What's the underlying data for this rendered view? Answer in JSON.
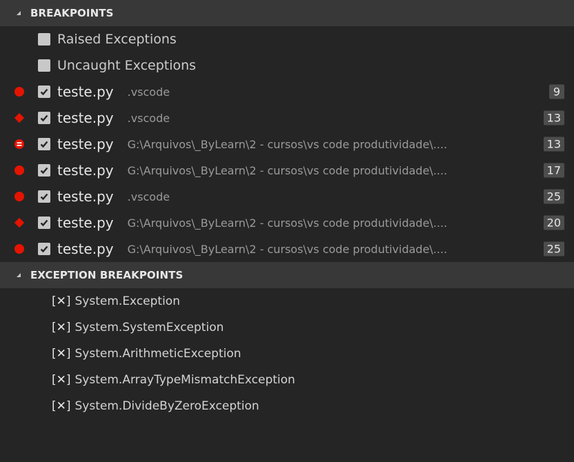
{
  "breakpoints": {
    "title": "BREAKPOINTS",
    "options": [
      {
        "label": "Raised Exceptions"
      },
      {
        "label": "Uncaught Exceptions"
      }
    ],
    "items": [
      {
        "icon": "breakpoint-dot-icon",
        "file": "teste.py",
        "path": ".vscode",
        "line": "9"
      },
      {
        "icon": "breakpoint-diamond-icon",
        "file": "teste.py",
        "path": ".vscode",
        "line": "13"
      },
      {
        "icon": "breakpoint-conditional-icon",
        "file": "teste.py",
        "path": "G:\\Arquivos\\_ByLearn\\2 - cursos\\vs code produtividade\\....",
        "line": "13"
      },
      {
        "icon": "breakpoint-dot-icon",
        "file": "teste.py",
        "path": "G:\\Arquivos\\_ByLearn\\2 - cursos\\vs code produtividade\\....",
        "line": "17"
      },
      {
        "icon": "breakpoint-dot-icon",
        "file": "teste.py",
        "path": ".vscode",
        "line": "25"
      },
      {
        "icon": "breakpoint-diamond-icon",
        "file": "teste.py",
        "path": "G:\\Arquivos\\_ByLearn\\2 - cursos\\vs code produtividade\\....",
        "line": "20"
      },
      {
        "icon": "breakpoint-dot-icon",
        "file": "teste.py",
        "path": "G:\\Arquivos\\_ByLearn\\2 - cursos\\vs code produtividade\\....",
        "line": "25"
      }
    ]
  },
  "exception_breakpoints": {
    "title": "EXCEPTION BREAKPOINTS",
    "mark": "[✕]",
    "items": [
      {
        "label": "System.Exception"
      },
      {
        "label": "System.SystemException"
      },
      {
        "label": "System.ArithmeticException"
      },
      {
        "label": "System.ArrayTypeMismatchException"
      },
      {
        "label": "System.DivideByZeroException"
      }
    ]
  },
  "colors": {
    "breakpoint_red": "#e51400",
    "background": "#252526",
    "header_bg": "#383838"
  }
}
